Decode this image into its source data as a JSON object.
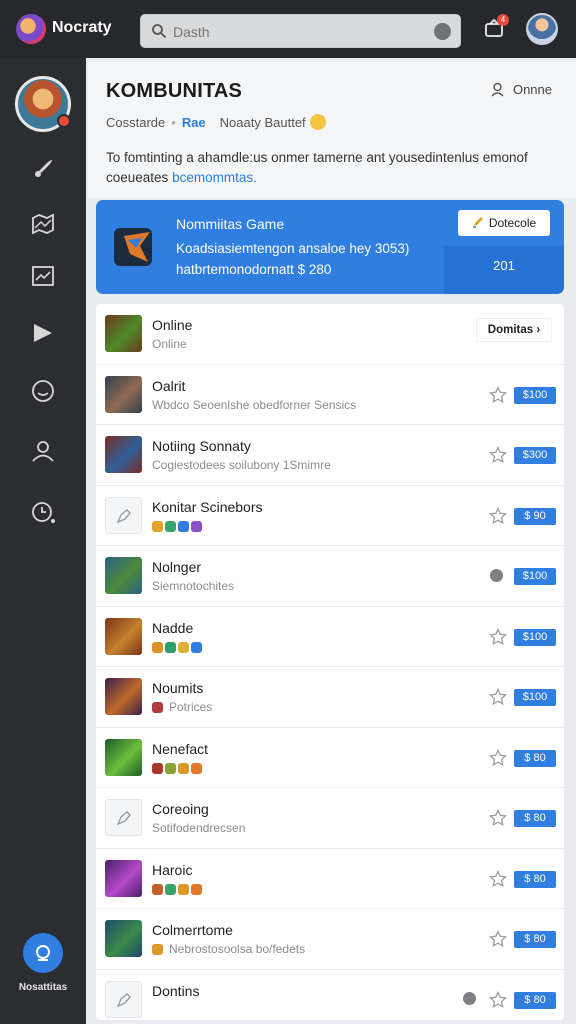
{
  "app": {
    "brand": "Nocraty"
  },
  "search": {
    "placeholder": "Dasth"
  },
  "notifications": {
    "badge": "4"
  },
  "header": {
    "title": "KOMBUNITAS",
    "status": "Onnne",
    "meta": {
      "item1": "Cosstarde",
      "link": "Rae",
      "item2": "Noaaty Bauttef"
    },
    "desc_text": "To fomtinting a ahamdle:us onmer tamerne ant yousedintenlus emonof coeueates",
    "desc_link": "bcemommtas."
  },
  "banner": {
    "title": "Nommiitas Game",
    "line1": "Koadsiasiemtengon ansaloe hey 3053)",
    "line2": "hatbrtemonodornatt $ 280",
    "button": "Dotecole",
    "value": "201"
  },
  "list": {
    "dropdown": "Domitas",
    "rows": [
      {
        "title": "Online",
        "sub": "Online",
        "thumb": "game",
        "thumb_colors": [
          "#6b3a1e",
          "#4f8a2a"
        ]
      },
      {
        "title": "Oalrit",
        "sub": "Wbdco Seoenlshe obedforner Sensics",
        "price": "$100",
        "thumb": "game",
        "thumb_colors": [
          "#34404d",
          "#8d6a52"
        ]
      },
      {
        "title": "Notiing Sonnaty",
        "sub": "Cogiestodees soilubony 1Smimre",
        "price": "$300",
        "thumb": "game",
        "thumb_colors": [
          "#7a2e23",
          "#2f5f9a"
        ]
      },
      {
        "title": "Konitar Scinebors",
        "chips": [
          "#e3a12a",
          "#3aa36b",
          "#2f7ee0",
          "#8a4fc9"
        ],
        "price": "$ 90",
        "thumb": "ghost"
      },
      {
        "title": "Nolnger",
        "sub": "Siemnotochites",
        "price": "$100",
        "thumb": "game",
        "thumb_colors": [
          "#2d5f86",
          "#4c8a3a"
        ],
        "extra": true
      },
      {
        "title": "Nadde",
        "chips": [
          "#d9932a",
          "#2f9d6a",
          "#e0b23a",
          "#2f7ee0"
        ],
        "price": "$100",
        "thumb": "game",
        "thumb_colors": [
          "#7b3418",
          "#c4822d"
        ]
      },
      {
        "title": "Noumits",
        "chips": [
          "#b23a3a"
        ],
        "sub_after_chip": "Potrices",
        "price": "$100",
        "thumb": "game",
        "thumb_colors": [
          "#3a1f4a",
          "#c06a2a"
        ]
      },
      {
        "title": "Nenefact",
        "chips": [
          "#a63a2a",
          "#8aa13a",
          "#d99a2a",
          "#e07a2a"
        ],
        "price": "$ 80",
        "thumb": "game",
        "thumb_colors": [
          "#1f5a2a",
          "#6abf3a"
        ]
      },
      {
        "title": "Coreoing",
        "sub": "Sotifodendrecsen",
        "price": "$ 80",
        "thumb": "ghost"
      },
      {
        "title": "Haroic",
        "chips": [
          "#c0602a",
          "#3aa36b",
          "#d99a2a",
          "#e07a2a"
        ],
        "price": "$ 80",
        "thumb": "game",
        "thumb_colors": [
          "#4a1f6a",
          "#b54ac9"
        ]
      },
      {
        "title": "Colmerrtome",
        "chips": [
          "#d99a2a"
        ],
        "sub_after_chip": "Nebrostosoolsa bo/fedets",
        "price": "$ 80",
        "thumb": "game",
        "thumb_colors": [
          "#1f4a6a",
          "#3a8a4a"
        ]
      },
      {
        "title": "Dontins",
        "price": "$ 80",
        "thumb": "ghost",
        "extra": true
      }
    ]
  },
  "sidebar": {
    "fab_label": "Nosattitas"
  },
  "colors": {
    "accent": "#2f7ee0",
    "sidebar": "#2b2d31",
    "topbar": "#26282c"
  },
  "icons": [
    "search-icon",
    "clear-icon",
    "notification-icon",
    "user-icon",
    "rocket-icon",
    "map-icon",
    "chart-icon",
    "play-icon",
    "smile-icon",
    "profile-icon",
    "timer-icon",
    "chat-icon",
    "star-icon",
    "edit-icon"
  ]
}
